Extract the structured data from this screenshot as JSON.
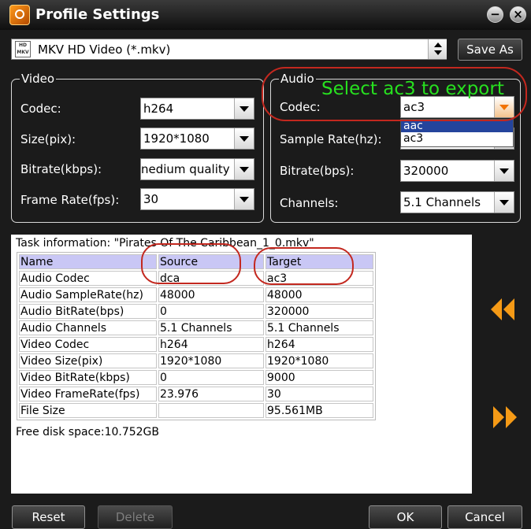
{
  "window": {
    "title": "Profile Settings"
  },
  "titlebar": {
    "minimize_symbol": "−",
    "close_symbol": "×"
  },
  "format": {
    "selected": "MKV HD Video (*.mkv)",
    "icon_text": "HD MKV"
  },
  "buttons": {
    "save_as": "Save As",
    "reset": "Reset",
    "delete": "Delete",
    "ok": "OK",
    "cancel": "Cancel"
  },
  "video": {
    "legend": "Video",
    "codec": {
      "label": "Codec:",
      "value": "h264"
    },
    "size": {
      "label": "Size(pix):",
      "value": "1920*1080"
    },
    "bitrate": {
      "label": "Bitrate(kbps):",
      "value": "nedium quality"
    },
    "frame_rate": {
      "label": "Frame Rate(fps):",
      "value": "30"
    }
  },
  "audio": {
    "legend": "Audio",
    "codec": {
      "label": "Codec:",
      "value": "ac3",
      "dropdown_options": [
        "aac",
        "ac3"
      ],
      "highlighted_option": "aac"
    },
    "sample_rate": {
      "label": "Sample Rate(hz):",
      "value": ""
    },
    "bitrate": {
      "label": "Bitrate(bps):",
      "value": "320000"
    },
    "channels": {
      "label": "Channels:",
      "value": "5.1 Channels"
    }
  },
  "annotation": {
    "text": "Select ac3 to export",
    "text_color": "#27e01f",
    "circle_color": "#c3281f"
  },
  "task": {
    "title": "Task information: \"Pirates Of The Caribbean_1_0.mkv\"",
    "columns": [
      "Name",
      "Source",
      "Target"
    ],
    "rows": [
      [
        "Audio Codec",
        "dca",
        "ac3"
      ],
      [
        "Audio SampleRate(hz)",
        "48000",
        "48000"
      ],
      [
        "Audio BitRate(bps)",
        "0",
        "320000"
      ],
      [
        "Audio Channels",
        "5.1 Channels",
        "5.1 Channels"
      ],
      [
        "Video Codec",
        "h264",
        "h264"
      ],
      [
        "Video Size(pix)",
        "1920*1080",
        "1920*1080"
      ],
      [
        "Video BitRate(kbps)",
        "0",
        "9000"
      ],
      [
        "Video FrameRate(fps)",
        "23.976",
        "30"
      ],
      [
        "File Size",
        "",
        "95.561MB"
      ]
    ],
    "free_disk": "Free disk space:10.752GB",
    "header_color": "#c9c7f5"
  },
  "icons": {
    "app": "app-logo-icon",
    "format": "mkv-file-icon",
    "previous": "double-chevron-left-icon",
    "next": "double-chevron-right-icon"
  },
  "colors": {
    "accent": "#f59a16",
    "window_bg": "#1b1b1b"
  }
}
